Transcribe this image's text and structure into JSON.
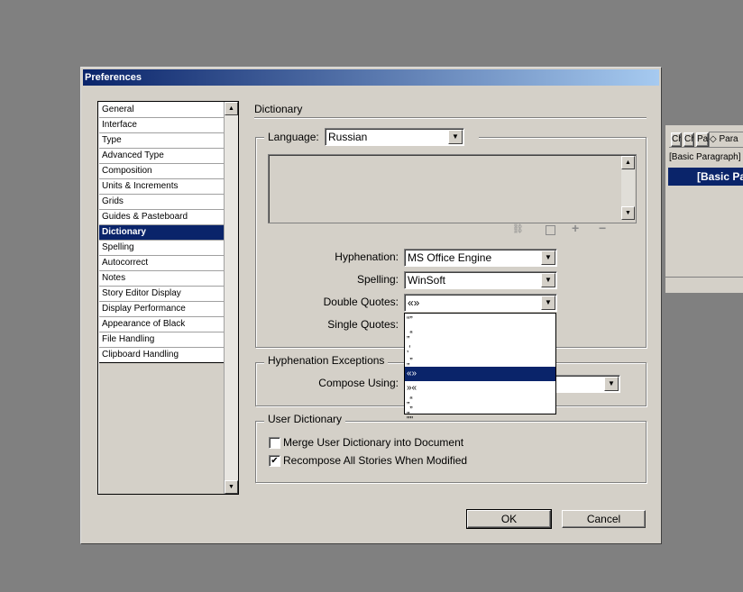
{
  "dialog": {
    "title": "Preferences",
    "categories": [
      "General",
      "Interface",
      "Type",
      "Advanced Type",
      "Composition",
      "Units & Increments",
      "Grids",
      "Guides & Pasteboard",
      "Dictionary",
      "Spelling",
      "Autocorrect",
      "Notes",
      "Story Editor Display",
      "Display Performance",
      "Appearance of Black",
      "File Handling",
      "Clipboard Handling"
    ],
    "selected_category": "Dictionary",
    "section_title": "Dictionary",
    "language_label": "Language:",
    "language_value": "Russian",
    "hyphenation_label": "Hyphenation:",
    "hyphenation_value": "MS Office Engine",
    "spelling_label": "Spelling:",
    "spelling_value": "WinSoft",
    "double_quotes_label": "Double Quotes:",
    "double_quotes_value": "«»",
    "single_quotes_label": "Single Quotes:",
    "quote_options": [
      "“”",
      "„“",
      "‚‘",
      "„”",
      "«»",
      "»«",
      "„“",
      "„”",
      "\"\""
    ],
    "quote_selected_index": 4,
    "hyphenation_exceptions_title": "Hyphenation Exceptions",
    "compose_using_label": "Compose Using:",
    "user_dictionary_title": "User Dictionary",
    "merge_label": "Merge User Dictionary into Document",
    "merge_checked": false,
    "recompose_label": "Recompose All Stories When Modified",
    "recompose_checked": true,
    "ok_label": "OK",
    "cancel_label": "Cancel"
  },
  "panel": {
    "tabs": [
      "Ch",
      "Ch",
      "Pa",
      "◇ Para"
    ],
    "style_name": "[Basic Paragraph]",
    "selected_style": "[Basic Pa"
  }
}
